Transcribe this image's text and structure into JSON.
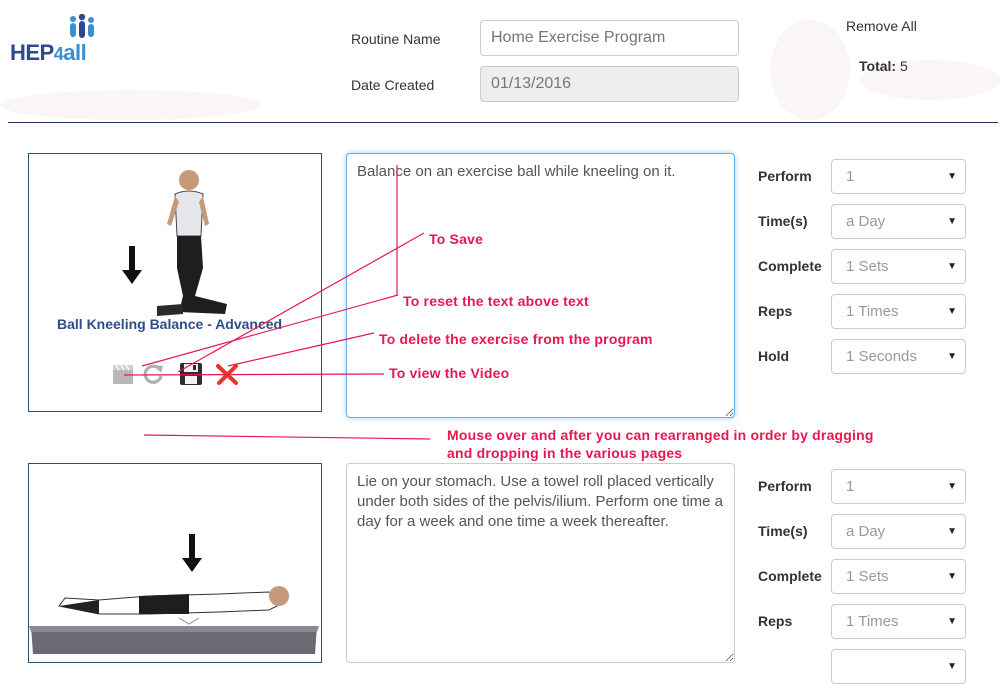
{
  "header": {
    "logo_text": {
      "hep": "HEP",
      "four": "4",
      "all": "all"
    },
    "routine_name_label": "Routine Name",
    "routine_name_placeholder": "Home Exercise Program",
    "date_created_label": "Date Created",
    "date_created_value": "01/13/2016",
    "remove_all_label": "Remove All",
    "total_label": "Total:",
    "total_value": "5"
  },
  "exercises": [
    {
      "title": "Ball Kneeling Balance - Advanced",
      "description": "Balance on an exercise ball while kneeling on it.",
      "options": [
        {
          "label": "Perform",
          "value": "1"
        },
        {
          "label": "Time(s)",
          "value": "a Day"
        },
        {
          "label": "Complete",
          "value": "1 Sets"
        },
        {
          "label": "Reps",
          "value": "1 Times"
        },
        {
          "label": "Hold",
          "value": "1 Seconds"
        }
      ]
    },
    {
      "title": "",
      "description": "Lie on your stomach. Use a towel roll placed vertically under both sides of the pelvis/ilium. Perform one time a day for a week and one time a week thereafter.",
      "options": [
        {
          "label": "Perform",
          "value": "1"
        },
        {
          "label": "Time(s)",
          "value": "a Day"
        },
        {
          "label": "Complete",
          "value": "1 Sets"
        },
        {
          "label": "Reps",
          "value": "1 Times"
        }
      ]
    }
  ],
  "annotations": {
    "save": "To Save",
    "reset": "To reset the text above text",
    "delete": "To delete the exercise from the program",
    "video": "To view the Video",
    "drag_line1": "Mouse over and after you can rearranged in order by dragging",
    "drag_line2": "and dropping in the various pages"
  },
  "colors": {
    "annotation": "#e8174f",
    "title": "#2f4c8c",
    "border": "#2f4f6f",
    "focus": "#66afe9"
  },
  "icons": [
    "video-clapper-icon",
    "reset-icon",
    "save-icon",
    "delete-icon",
    "chevron-down-icon",
    "arrow-down-icon"
  ]
}
